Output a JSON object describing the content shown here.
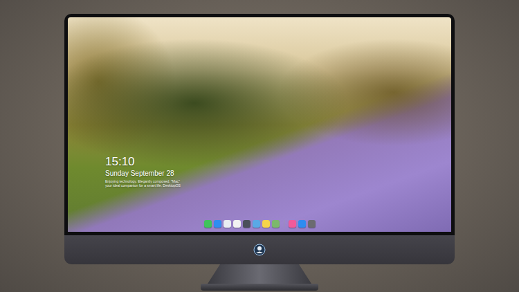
{
  "lock_screen": {
    "time": "15:10",
    "date": "Sunday September 28",
    "caption": [
      "Enjoying technology. Elegantly composed. \"Mac\"",
      "your ideal companion for a smart life. DesktopOS"
    ]
  },
  "dock": {
    "items": [
      {
        "kind": "app",
        "color": "#3fc35b"
      },
      {
        "kind": "app",
        "color": "#2f8df0"
      },
      {
        "kind": "app",
        "color": "#e9edf2"
      },
      {
        "kind": "app",
        "color": "#f2f2f2"
      },
      {
        "kind": "app",
        "color": "#4a4f5a"
      },
      {
        "kind": "app",
        "color": "#5aa9e6"
      },
      {
        "kind": "app",
        "color": "#f6d44a"
      },
      {
        "kind": "app",
        "color": "#7cb86b"
      },
      {
        "kind": "divider",
        "color": "#9a9a9a"
      },
      {
        "kind": "app",
        "color": "#f05a9a"
      },
      {
        "kind": "app",
        "color": "#2e8cf0"
      },
      {
        "kind": "app",
        "color": "#6b6b70"
      }
    ]
  }
}
